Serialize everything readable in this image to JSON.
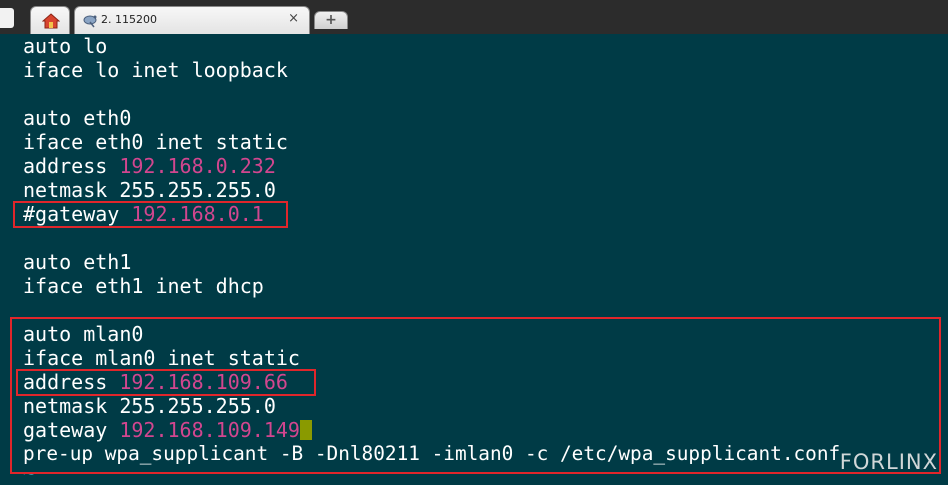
{
  "tabs": {
    "session_label": "2. 115200",
    "close_glyph": "×",
    "new_tab_glyph": "+"
  },
  "terminal": {
    "lines": [
      {
        "text": "auto lo",
        "ip": ""
      },
      {
        "text": "iface lo inet loopback",
        "ip": ""
      },
      {
        "text": "",
        "ip": ""
      },
      {
        "text": "auto eth0",
        "ip": ""
      },
      {
        "text": "iface eth0 inet static",
        "ip": ""
      },
      {
        "text": "address ",
        "ip": "192.168.0.232"
      },
      {
        "text": "netmask 255.255.255.0",
        "ip": ""
      },
      {
        "text": "#gateway ",
        "ip": "192.168.0.1"
      },
      {
        "text": "",
        "ip": ""
      },
      {
        "text": "auto eth1",
        "ip": ""
      },
      {
        "text": "iface eth1 inet dhcp",
        "ip": ""
      },
      {
        "text": "",
        "ip": ""
      },
      {
        "text": "auto mlan0",
        "ip": ""
      },
      {
        "text": "iface mlan0 inet static",
        "ip": ""
      },
      {
        "text": "address ",
        "ip": "192.168.109.66"
      },
      {
        "text": "netmask 255.255.255.0",
        "ip": ""
      },
      {
        "text": "gateway ",
        "ip": "192.168.109.149"
      },
      {
        "text": "pre-up wpa_supplicant -B -Dnl80211 -imlan0 -c /etc/wpa_supplicant.conf",
        "ip": ""
      }
    ],
    "tilde": "~"
  },
  "watermark": "FORLINX",
  "colors": {
    "background": "#003b46",
    "text": "#ffffff",
    "ip_highlight": "#d2468f",
    "cursor": "#8a9a00",
    "annotation_box": "#e0262b"
  },
  "icons": {
    "home_tab": "home-icon",
    "session_tab": "satellite-dish-icon"
  }
}
